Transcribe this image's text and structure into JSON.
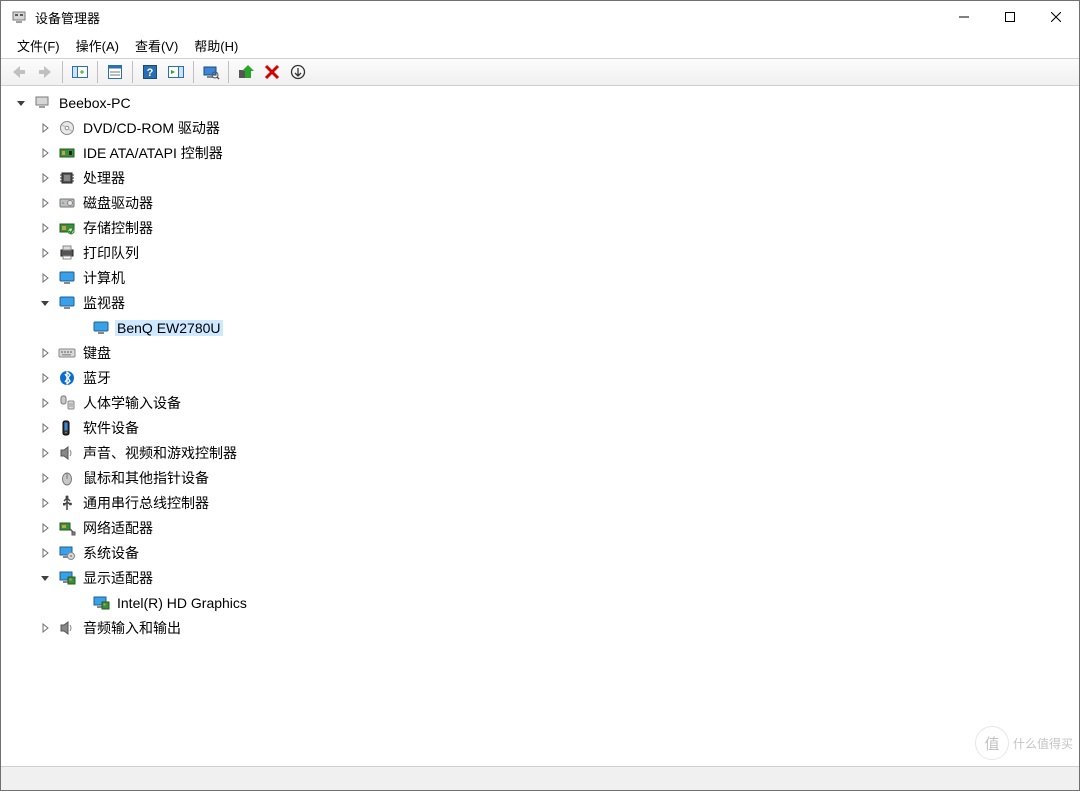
{
  "window": {
    "title": "设备管理器"
  },
  "menubar": {
    "file": "文件(F)",
    "action": "操作(A)",
    "view": "查看(V)",
    "help": "帮助(H)"
  },
  "tree": {
    "root": {
      "label": "Beebox-PC"
    },
    "nodes": [
      {
        "key": "dvd",
        "label": "DVD/CD-ROM 驱动器",
        "icon": "disc",
        "expanded": false
      },
      {
        "key": "ide",
        "label": "IDE ATA/ATAPI 控制器",
        "icon": "ide",
        "expanded": false
      },
      {
        "key": "cpu",
        "label": "处理器",
        "icon": "cpu",
        "expanded": false
      },
      {
        "key": "disk",
        "label": "磁盘驱动器",
        "icon": "hdd",
        "expanded": false
      },
      {
        "key": "storage",
        "label": "存储控制器",
        "icon": "storage",
        "expanded": false
      },
      {
        "key": "print",
        "label": "打印队列",
        "icon": "printer",
        "expanded": false
      },
      {
        "key": "computer",
        "label": "计算机",
        "icon": "monitor",
        "expanded": false
      },
      {
        "key": "monitor",
        "label": "监视器",
        "icon": "monitor",
        "expanded": true,
        "children": [
          {
            "key": "benq",
            "label": "BenQ EW2780U",
            "icon": "monitor",
            "selected": true
          }
        ]
      },
      {
        "key": "keyboard",
        "label": "键盘",
        "icon": "keyboard",
        "expanded": false
      },
      {
        "key": "bluetooth",
        "label": "蓝牙",
        "icon": "bt",
        "expanded": false
      },
      {
        "key": "hid",
        "label": "人体学输入设备",
        "icon": "hid",
        "expanded": false
      },
      {
        "key": "software",
        "label": "软件设备",
        "icon": "software",
        "expanded": false
      },
      {
        "key": "sound",
        "label": "声音、视频和游戏控制器",
        "icon": "speaker",
        "expanded": false
      },
      {
        "key": "mouse",
        "label": "鼠标和其他指针设备",
        "icon": "mouse",
        "expanded": false
      },
      {
        "key": "usb",
        "label": "通用串行总线控制器",
        "icon": "usb",
        "expanded": false
      },
      {
        "key": "netadapter",
        "label": "网络适配器",
        "icon": "net",
        "expanded": false
      },
      {
        "key": "system",
        "label": "系统设备",
        "icon": "system",
        "expanded": false
      },
      {
        "key": "display",
        "label": "显示适配器",
        "icon": "display",
        "expanded": true,
        "children": [
          {
            "key": "intelhd",
            "label": "Intel(R) HD Graphics",
            "icon": "display"
          }
        ]
      },
      {
        "key": "audio",
        "label": "音频输入和输出",
        "icon": "speaker",
        "expanded": false
      }
    ]
  },
  "watermark": {
    "badge": "值",
    "text": "什么值得买"
  }
}
